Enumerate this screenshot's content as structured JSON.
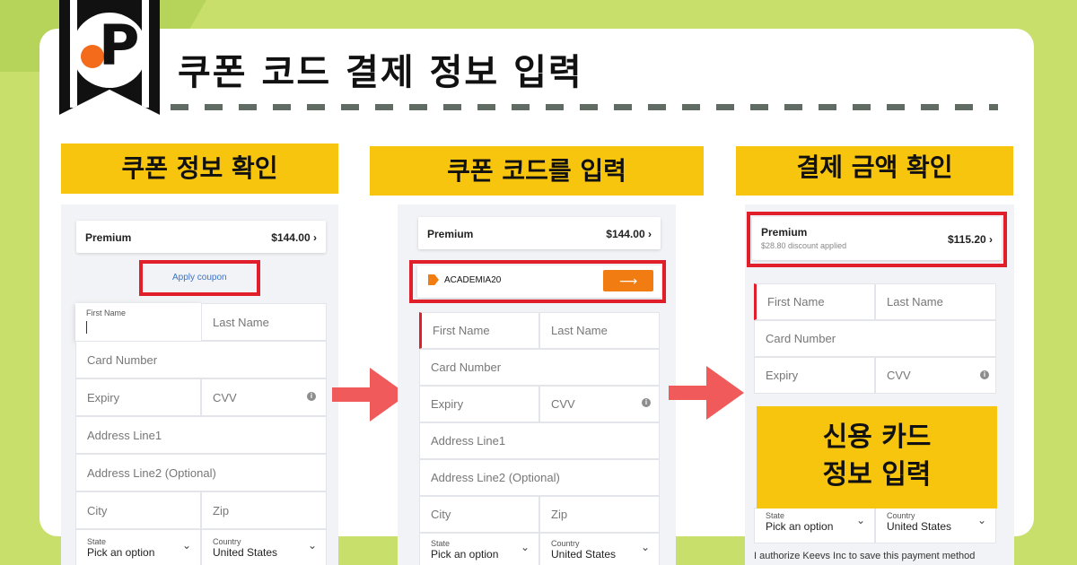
{
  "title": "쿠폰 코드 결제 정보 입력",
  "logo_letter": "P",
  "panels": [
    {
      "header": "쿠폰 정보 확인",
      "plan": {
        "name": "Premium",
        "price": "$144.00 ›"
      },
      "apply_coupon": "Apply coupon",
      "fields": {
        "first_name_label": "First Name",
        "last_name": "Last Name",
        "card_number": "Card Number",
        "expiry": "Expiry",
        "cvv": "CVV",
        "address1": "Address Line1",
        "address2": "Address Line2 (Optional)",
        "city": "City",
        "zip": "Zip",
        "state_label": "State",
        "state_value": "Pick an option",
        "country_label": "Country",
        "country_value": "United States"
      }
    },
    {
      "header": "쿠폰 코드를 입력",
      "plan": {
        "name": "Premium",
        "price": "$144.00 ›"
      },
      "coupon_code": "ACADEMIA20",
      "submit_arrow": "⟶",
      "fields": {
        "first_name": "First Name",
        "last_name": "Last Name",
        "card_number": "Card Number",
        "expiry": "Expiry",
        "cvv": "CVV",
        "address1": "Address Line1",
        "address2": "Address Line2 (Optional)",
        "city": "City",
        "zip": "Zip",
        "state_label": "State",
        "state_value": "Pick an option",
        "country_label": "Country",
        "country_value": "United States"
      }
    },
    {
      "header": "결제 금액 확인",
      "plan": {
        "name": "Premium",
        "discount": "$28.80 discount applied",
        "price": "$115.20 ›"
      },
      "fields": {
        "first_name": "First Name",
        "last_name": "Last Name",
        "card_number": "Card Number",
        "expiry": "Expiry",
        "cvv": "CVV",
        "state_label": "State",
        "state_value": "Pick an option",
        "country_label": "Country",
        "country_value": "United States"
      },
      "overlay_line1": "신용 카드",
      "overlay_line2": "정보 입력",
      "authorize": "I authorize Keevs Inc to save this payment method"
    }
  ],
  "colors": {
    "accent_yellow": "#f7c40e",
    "highlight_red": "#e01f2b",
    "orange_button": "#f07c12",
    "arrow_red": "#f05a5a",
    "background": "#c8e06b"
  }
}
